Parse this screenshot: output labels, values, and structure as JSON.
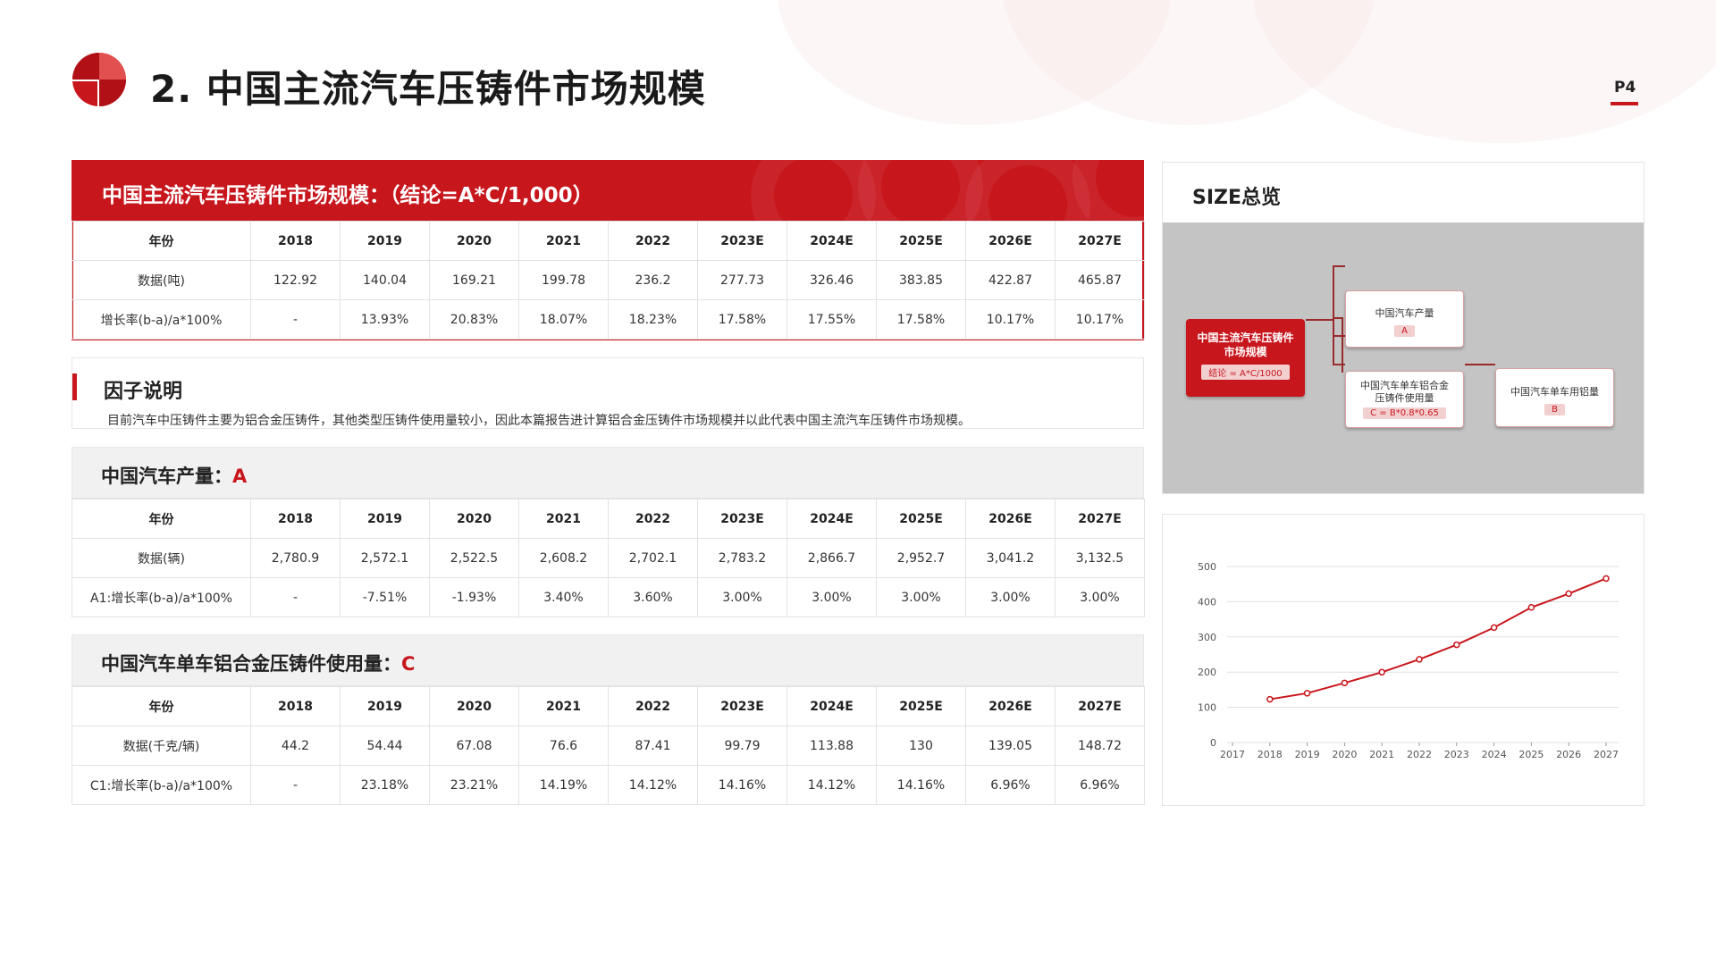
{
  "header": {
    "title": "2.  中国主流汽车压铸件市场规模",
    "page": "P4"
  },
  "market": {
    "title": "中国主流汽车压铸件市场规模：（结论=A*C/1,000）",
    "years": [
      "年份",
      "2018",
      "2019",
      "2020",
      "2021",
      "2022",
      "2023E",
      "2024E",
      "2025E",
      "2026E",
      "2027E"
    ],
    "data": [
      "数据(吨)",
      "122.92",
      "140.04",
      "169.21",
      "199.78",
      "236.2",
      "277.73",
      "326.46",
      "383.85",
      "422.87",
      "465.87"
    ],
    "growth": [
      "增长率(b-a)/a*100%",
      "-",
      "13.93%",
      "20.83%",
      "18.07%",
      "18.23%",
      "17.58%",
      "17.55%",
      "17.58%",
      "10.17%",
      "10.17%"
    ]
  },
  "factor": {
    "title": "因子说明",
    "text": "目前汽车中压铸件主要为铝合金压铸件，其他类型压铸件使用量较小，因此本篇报告进计算铝合金压铸件市场规模并以此代表中国主流汽车压铸件市场规模。"
  },
  "production": {
    "label": "中国汽车产量：",
    "accent": "A",
    "years": [
      "年份",
      "2018",
      "2019",
      "2020",
      "2021",
      "2022",
      "2023E",
      "2024E",
      "2025E",
      "2026E",
      "2027E"
    ],
    "data": [
      "数据(辆)",
      "2,780.9",
      "2,572.1",
      "2,522.5",
      "2,608.2",
      "2,702.1",
      "2,783.2",
      "2,866.7",
      "2,952.7",
      "3,041.2",
      "3,132.5"
    ],
    "growth": [
      "A1:增长率(b-a)/a*100%",
      "-",
      "-7.51%",
      "-1.93%",
      "3.40%",
      "3.60%",
      "3.00%",
      "3.00%",
      "3.00%",
      "3.00%",
      "3.00%"
    ]
  },
  "usage": {
    "label": "中国汽车单车铝合金压铸件使用量：",
    "accent": "C",
    "years": [
      "年份",
      "2018",
      "2019",
      "2020",
      "2021",
      "2022",
      "2023E",
      "2024E",
      "2025E",
      "2026E",
      "2027E"
    ],
    "data": [
      "数据(千克/辆)",
      "44.2",
      "54.44",
      "67.08",
      "76.6",
      "87.41",
      "99.79",
      "113.88",
      "130",
      "139.05",
      "148.72"
    ],
    "growth": [
      "C1:增长率(b-a)/a*100%",
      "-",
      "23.18%",
      "23.21%",
      "14.19%",
      "14.12%",
      "14.16%",
      "14.12%",
      "14.16%",
      "6.96%",
      "6.96%"
    ]
  },
  "size": {
    "title": "SIZE总览",
    "main_node": "中国主流汽车压铸件市场规模",
    "main_tag": "结论 = A*C/1000",
    "node_a": "中国汽车产量",
    "node_a_tag": "A",
    "node_c": "中国汽车单车铝合金压铸件使用量",
    "node_c_tag": "C = B*0.8*0.65",
    "node_b": "中国汽车单车用铝量",
    "node_b_tag": "B"
  },
  "chart_data": {
    "type": "line",
    "x": [
      "2017",
      "2018",
      "2019",
      "2020",
      "2021",
      "2022",
      "2023",
      "2024",
      "2025",
      "2026",
      "2027"
    ],
    "series": [
      {
        "values": [
          null,
          122.92,
          140.04,
          169.21,
          199.78,
          236.2,
          277.73,
          326.46,
          383.85,
          422.87,
          465.87
        ]
      }
    ],
    "yticks": [
      "0",
      "100",
      "200",
      "300",
      "400",
      "500"
    ],
    "ylim": [
      0,
      500
    ],
    "grid": true,
    "color": "#c8161d"
  }
}
